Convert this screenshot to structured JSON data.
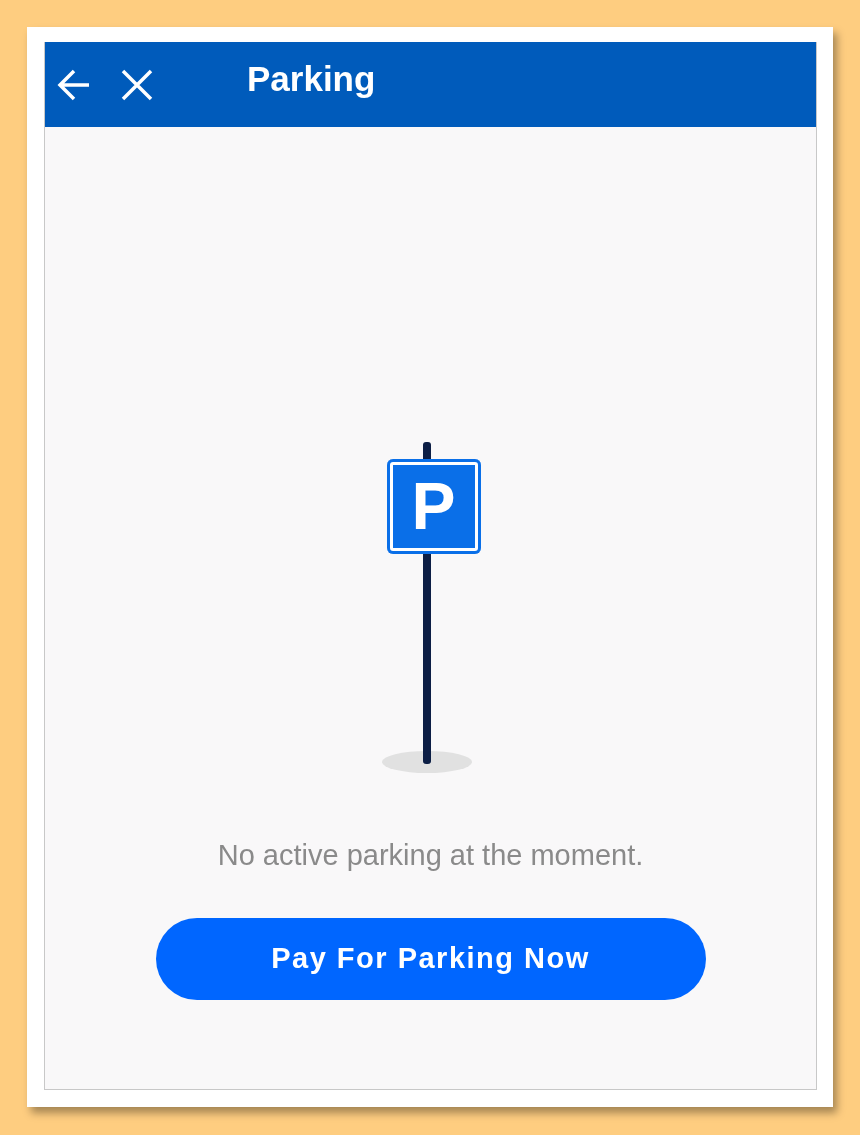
{
  "header": {
    "title": "Parking"
  },
  "sign": {
    "letter": "P"
  },
  "message": "No active parking at the moment.",
  "button": {
    "label": "Pay For Parking Now"
  }
}
